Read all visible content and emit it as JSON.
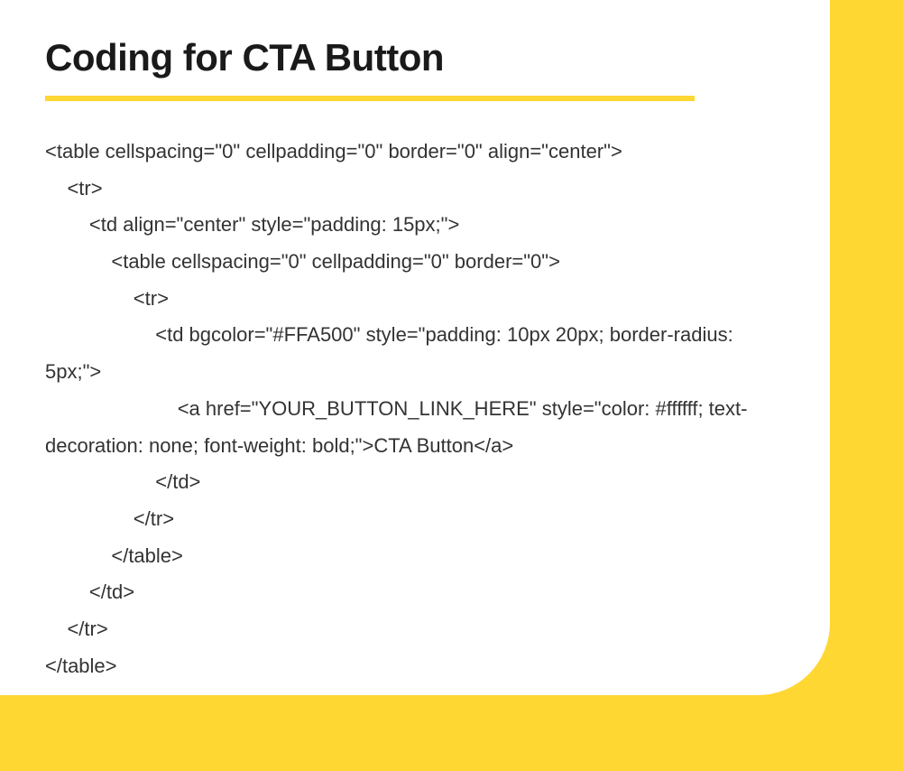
{
  "heading": "Coding for CTA Button",
  "code": "<table cellspacing=\"0\" cellpadding=\"0\" border=\"0\" align=\"center\">\n    <tr>\n        <td align=\"center\" style=\"padding: 15px;\">\n            <table cellspacing=\"0\" cellpadding=\"0\" border=\"0\">\n                <tr>\n                    <td bgcolor=\"#FFA500\" style=\"padding: 10px 20px; border-radius: 5px;\">\n                        <a href=\"YOUR_BUTTON_LINK_HERE\" style=\"color: #ffffff; text-decoration: none; font-weight: bold;\">CTA Button</a>\n                    </td>\n                </tr>\n            </table>\n        </td>\n    </tr>\n</table>",
  "colors": {
    "accent": "#ffd733",
    "text": "#1a1a1a",
    "code_text": "#333333"
  }
}
